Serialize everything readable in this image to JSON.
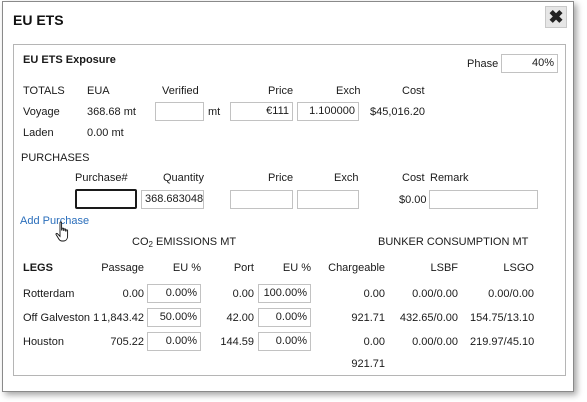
{
  "dialog": {
    "title": "EU ETS",
    "close_glyph": "✖"
  },
  "exposure": {
    "heading": "EU ETS Exposure",
    "phase_label": "Phase",
    "phase_value": "40%"
  },
  "totals": {
    "section_label": "TOTALS",
    "headers": {
      "eua": "EUA",
      "verified": "Verified",
      "price": "Price",
      "exch": "Exch",
      "cost": "Cost"
    },
    "voyage": {
      "label": "Voyage",
      "eua": "368.68 mt",
      "verified_value": "",
      "verified_unit": "mt",
      "price": "€111",
      "exch": "1.100000",
      "cost": "$45,016.20"
    },
    "laden": {
      "label": "Laden",
      "eua": "0.00 mt"
    }
  },
  "purchases": {
    "section_label": "PURCHASES",
    "headers": {
      "purchase_no": "Purchase#",
      "quantity": "Quantity",
      "price": "Price",
      "exch": "Exch",
      "cost": "Cost",
      "remark": "Remark"
    },
    "row": {
      "purchase_no": "",
      "quantity": "368.683048",
      "price": "",
      "exch": "",
      "cost": "$0.00",
      "remark": ""
    },
    "add_label": "Add Purchase"
  },
  "emissions": {
    "co2_heading_prefix": "CO",
    "co2_heading_sub": "2",
    "co2_heading_suffix": " EMISSIONS MT",
    "bunker_heading": "BUNKER CONSUMPTION MT",
    "headers": {
      "legs": "LEGS",
      "passage": "Passage",
      "eu_pct": "EU %",
      "port": "Port",
      "eu_pct2": "EU %",
      "chargeable": "Chargeable",
      "lsbf": "LSBF",
      "lsgo": "LSGO"
    },
    "rows": [
      {
        "leg": "Rotterdam",
        "passage": "0.00",
        "passage_eu": "0.00%",
        "port": "0.00",
        "port_eu": "100.00%",
        "chargeable": "0.00",
        "lsbf": "0.00/0.00",
        "lsgo": "0.00/0.00"
      },
      {
        "leg": "Off Galveston 1",
        "passage": "1,843.42",
        "passage_eu": "50.00%",
        "port": "42.00",
        "port_eu": "0.00%",
        "chargeable": "921.71",
        "lsbf": "432.65/0.00",
        "lsgo": "154.75/13.10"
      },
      {
        "leg": "Houston",
        "passage": "705.22",
        "passage_eu": "0.00%",
        "port": "144.59",
        "port_eu": "0.00%",
        "chargeable": "0.00",
        "lsbf": "0.00/0.00",
        "lsgo": "219.97/45.10"
      }
    ],
    "total_chargeable": "921.71"
  }
}
